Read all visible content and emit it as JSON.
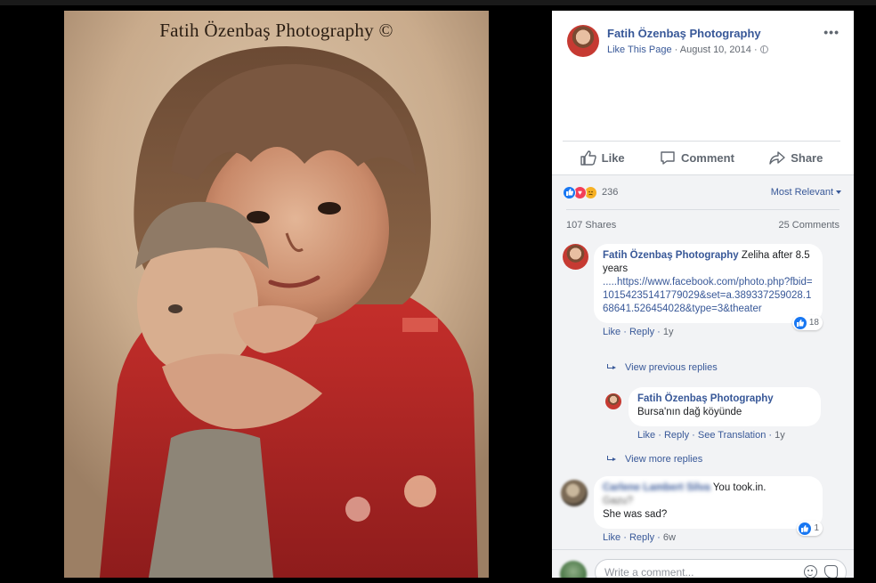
{
  "photo": {
    "watermark": "Fatih Özenbaş Photography ©"
  },
  "post": {
    "page_name": "Fatih Özenbaş Photography",
    "like_this_page": "Like This Page",
    "date": "August 10, 2014",
    "more_icon": "ellipsis-icon"
  },
  "actions": {
    "like": "Like",
    "comment": "Comment",
    "share": "Share"
  },
  "summary": {
    "reaction_count": "236",
    "sort_label": "Most Relevant",
    "shares": "107 Shares",
    "comments": "25 Comments"
  },
  "comments": [
    {
      "author": "Fatih Özenbaş Photography",
      "text": "Zeliha after 8.5 years",
      "url": ".....https://www.facebook.com/photo.php?fbid=10154235141779029&set=a.389337259028.168641.526454028&type=3&theater",
      "like_label": "Like",
      "reply_label": "Reply",
      "time": "1y",
      "like_count": "18"
    },
    {
      "author": "Fatih Özenbaş Photography",
      "text": "Bursa'nın dağ köyünde",
      "like_label": "Like",
      "reply_label": "Reply",
      "see_translation": "See Translation",
      "time": "1y"
    },
    {
      "author": "Carlene Lambert Silva",
      "text_visible": "You took.in.",
      "text_blurred": "Gazu?",
      "text_line2": "She was sad?",
      "like_label": "Like",
      "reply_label": "Reply",
      "time": "6w",
      "like_count": "1"
    }
  ],
  "view_previous_replies": "View previous replies",
  "view_more_replies": "View more replies",
  "composer": {
    "placeholder": "Write a comment..."
  },
  "colors": {
    "link": "#385898",
    "like_blue": "#1877f2",
    "love_red": "#f33e58",
    "sad_yellow": "#f7b125"
  }
}
